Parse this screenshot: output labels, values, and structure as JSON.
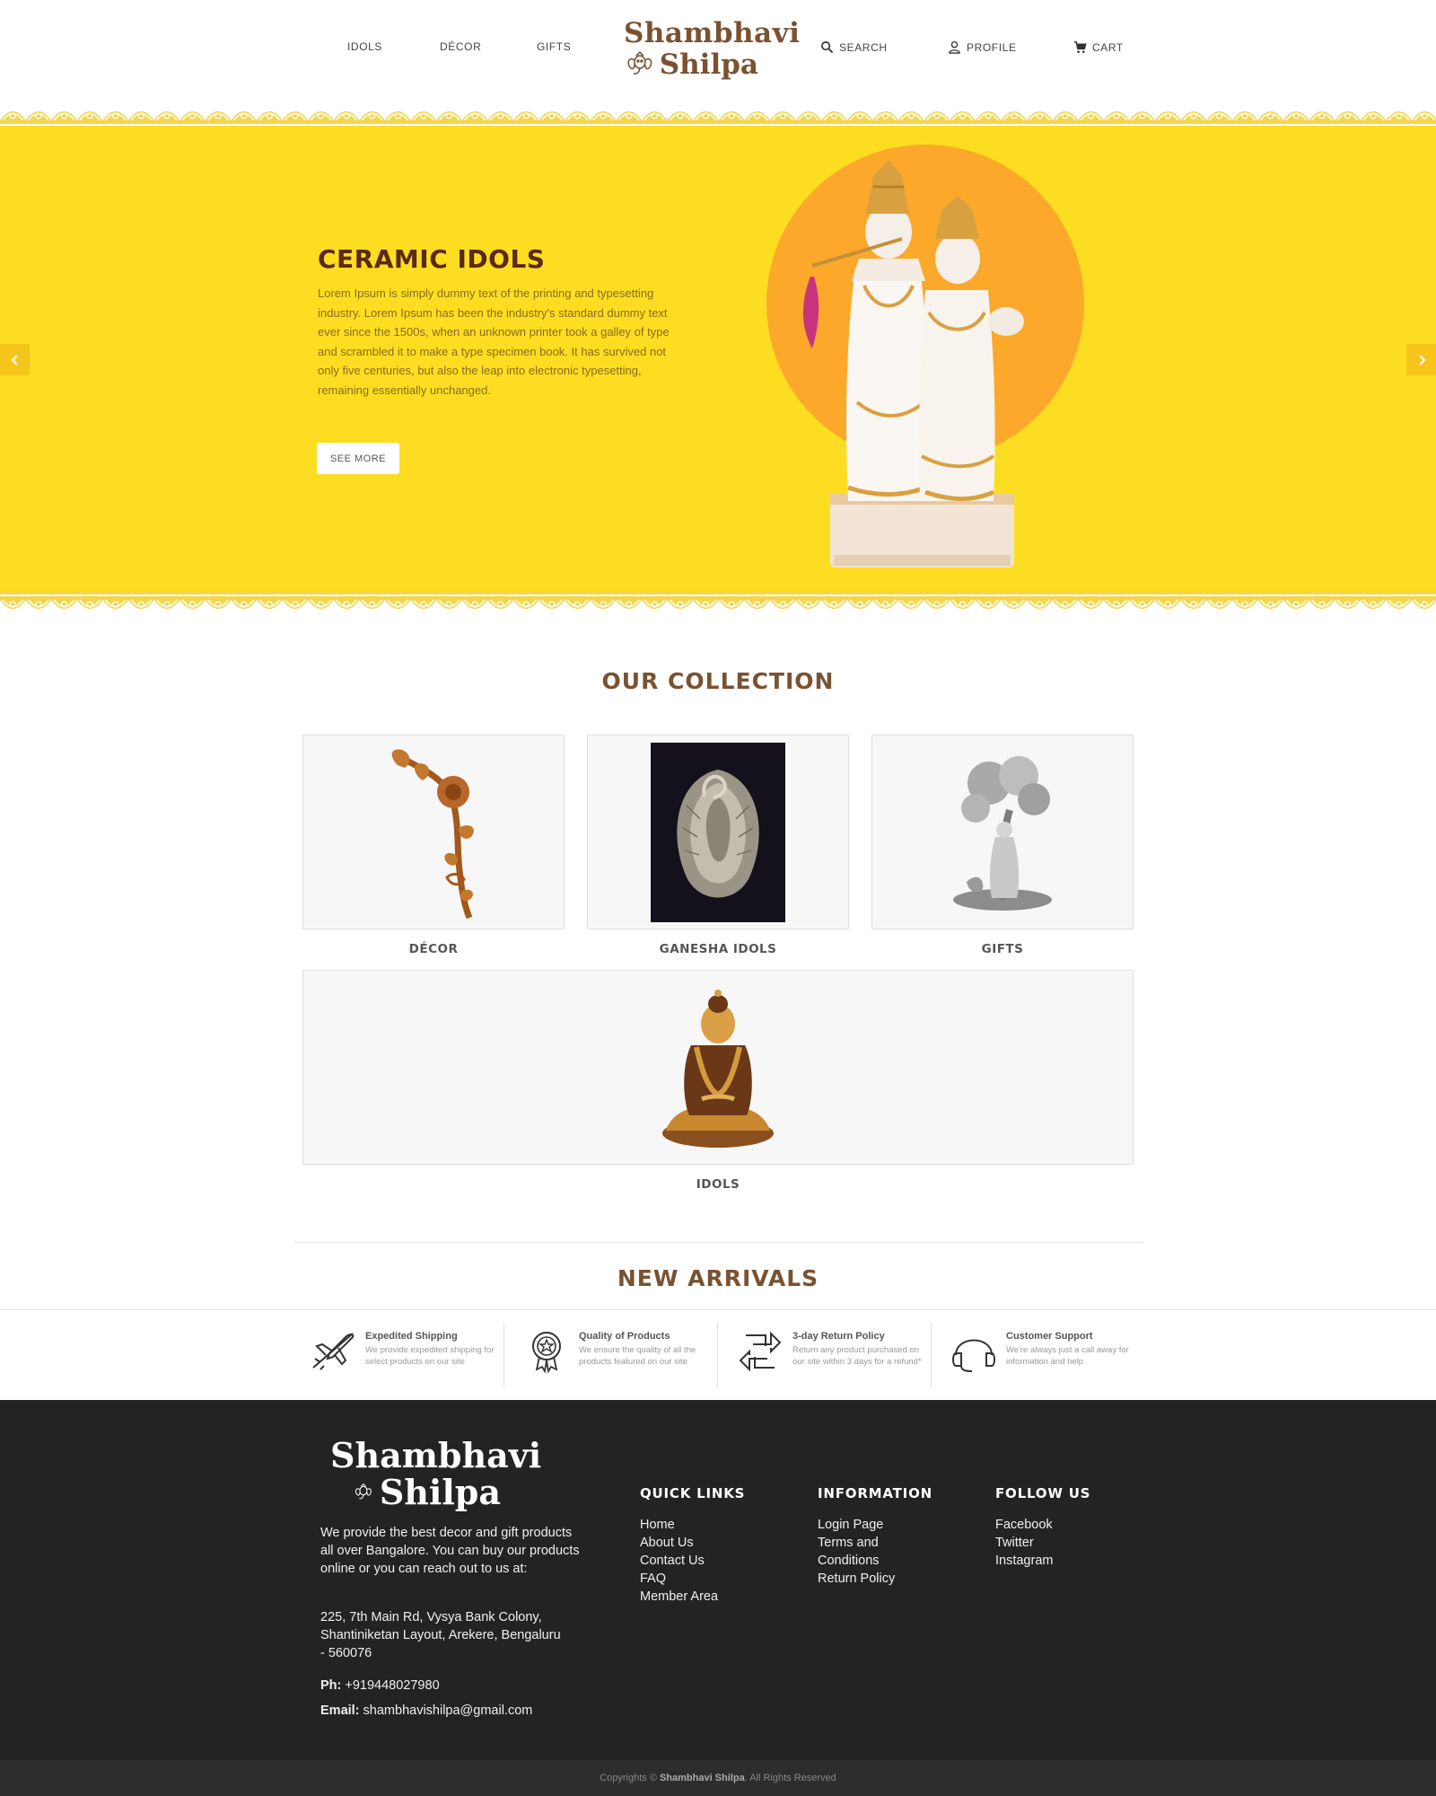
{
  "nav": {
    "idols": "IDOLS",
    "decor": "DÉCOR",
    "gifts": "GIFTS",
    "logo_line1": "Shambhavi",
    "logo_line2": "Shilpa",
    "search": "SEARCH",
    "profile": "PROFILE",
    "cart": "CART"
  },
  "banner": {
    "title": "CERAMIC IDOLS",
    "text": "Lorem Ipsum is simply dummy text of the printing and typesetting industry. Lorem Ipsum has been the industry's standard dummy text ever since the 1500s, when an unknown printer took a galley of type and scrambled it to make a type specimen book. It has survived not only five centuries, but also the leap into electronic typesetting, remaining essentially unchanged.",
    "button": "SEE MORE",
    "bg_color": "#fddd21",
    "accent_color": "#f6c51b"
  },
  "collection": {
    "title": "OUR COLLECTION",
    "items": [
      {
        "label": "DÉCOR"
      },
      {
        "label": "GANESHA IDOLS"
      },
      {
        "label": "GIFTS"
      },
      {
        "label": "IDOLS"
      }
    ]
  },
  "new_arrivals": {
    "title": "NEW ARRIVALS"
  },
  "features": [
    {
      "title": "Expedited Shipping",
      "desc": "We provide expedited shipping for select products on our site",
      "icon": "airplane-icon"
    },
    {
      "title": "Quality of Products",
      "desc": "We ensure the quality of all the products featured on our site",
      "icon": "award-badge-icon"
    },
    {
      "title": "3-day Return Policy",
      "desc": "Return any product purchased on our site within 3 days for a refund*",
      "icon": "return-arrows-icon"
    },
    {
      "title": "Customer Support",
      "desc": "We're always just a call away for information and help",
      "icon": "headset-icon"
    }
  ],
  "footer": {
    "logo_line1": "Shambhavi",
    "logo_line2": "Shilpa",
    "about": "We provide the best decor and gift products all over Bangalore. You can buy our products online or you can reach out to us at:",
    "address": "225, 7th Main Rd, Vysya Bank Colony, Shantiniketan Layout, Arekere, Bengaluru - 560076",
    "phone_label": "Ph:",
    "phone": "+919448027980",
    "email_label": "Email:",
    "email": "shambhavishilpa@gmail.com",
    "quick_links": {
      "title": "QUICK LINKS",
      "items": [
        "Home",
        "About Us",
        "Contact Us",
        "FAQ",
        "Member Area"
      ]
    },
    "information": {
      "title": "INFORMATION",
      "items": [
        "Login Page",
        "Terms and Conditions",
        "Return Policy"
      ]
    },
    "follow": {
      "title": "FOLLOW US",
      "items": [
        "Facebook",
        "Twitter",
        "Instagram"
      ]
    }
  },
  "copyright": {
    "prefix": "Copyrights ©",
    "brand": "Shambhavi Shilpa",
    "suffix": ". All Rights Reserved"
  }
}
